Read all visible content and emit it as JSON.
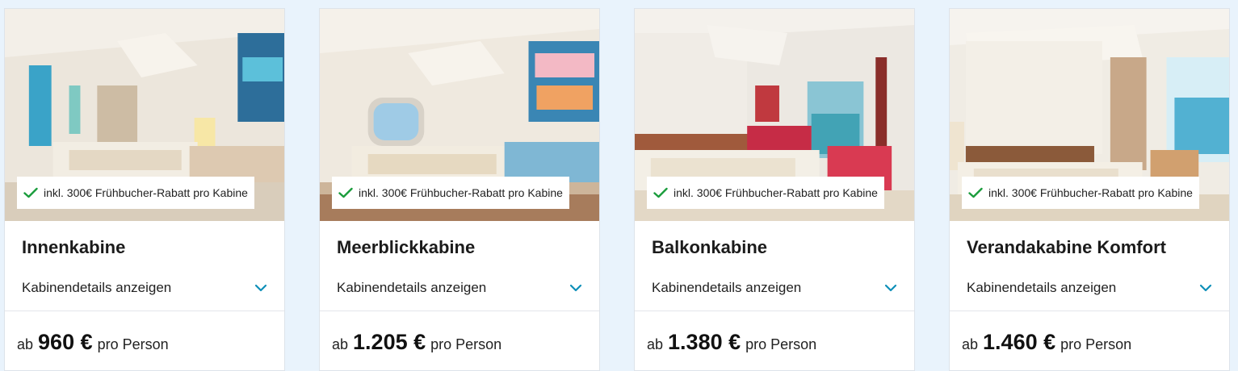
{
  "cabins": [
    {
      "badge": "inkl. 300€ Frühbucher-Rabatt pro Kabine",
      "title": "Innenkabine",
      "details_label": "Kabinendetails anzeigen",
      "price_prefix": "ab",
      "price": "960 €",
      "price_suffix": "pro Person"
    },
    {
      "badge": "inkl. 300€ Frühbucher-Rabatt pro Kabine",
      "title": "Meerblickkabine",
      "details_label": "Kabinendetails anzeigen",
      "price_prefix": "ab",
      "price": "1.205 €",
      "price_suffix": "pro Person"
    },
    {
      "badge": "inkl. 300€ Frühbucher-Rabatt pro Kabine",
      "title": "Balkonkabine",
      "details_label": "Kabinendetails anzeigen",
      "price_prefix": "ab",
      "price": "1.380 €",
      "price_suffix": "pro Person"
    },
    {
      "badge": "inkl. 300€ Frühbucher-Rabatt pro Kabine",
      "title": "Verandakabine Komfort",
      "details_label": "Kabinendetails anzeigen",
      "price_prefix": "ab",
      "price": "1.460 €",
      "price_suffix": "pro Person"
    }
  ],
  "colors": {
    "page_background": "#e9f3fc",
    "check_green": "#1a9c3c",
    "chevron_teal": "#0e8fb8"
  },
  "icons": {
    "badge": "check-icon",
    "details": "chevron-down-icon"
  }
}
